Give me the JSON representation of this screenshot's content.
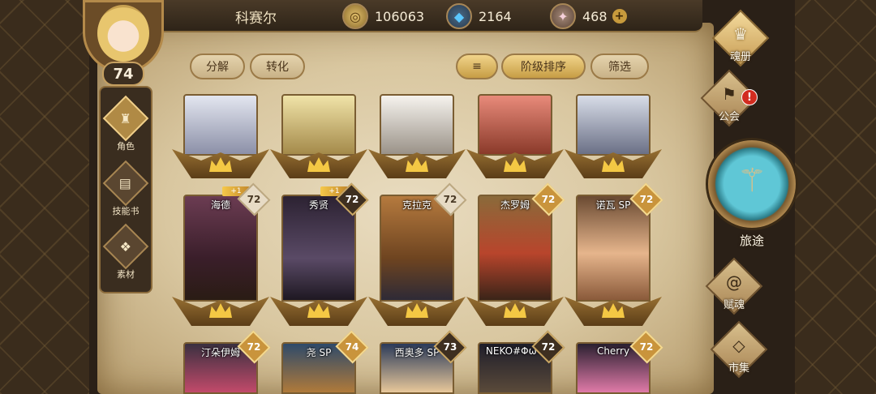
{
  "player": {
    "name": "科赛尔",
    "level": "74"
  },
  "resources": {
    "gold": "106063",
    "gems": "2164",
    "crystals": "468",
    "add_label": "+"
  },
  "toolbar": {
    "decompose": "分解",
    "convert": "转化",
    "sort_by_tier": "阶级排序",
    "filter": "筛选"
  },
  "left_nav": [
    {
      "label": "角色",
      "icon": "helmet-icon"
    },
    {
      "label": "技能书",
      "icon": "skillbook-icon"
    },
    {
      "label": "素材",
      "icon": "material-icon"
    }
  ],
  "right_nav": {
    "soul_book": "魂册",
    "guild": "公会",
    "guild_alert": "!",
    "journey": "旅途",
    "endow_soul": "赋魂",
    "market": "市集"
  },
  "cards_row1": [
    {
      "name": "",
      "level": ""
    },
    {
      "name": "",
      "level": ""
    },
    {
      "name": "",
      "level": ""
    },
    {
      "name": "",
      "level": ""
    },
    {
      "name": "",
      "level": ""
    }
  ],
  "cards_row2": [
    {
      "name": "海德",
      "level": "72",
      "bonus": "+1",
      "badge": "plain"
    },
    {
      "name": "秀贤",
      "level": "72",
      "bonus": "+1",
      "badge": "dark"
    },
    {
      "name": "克拉克",
      "level": "72",
      "bonus": "",
      "badge": "plain"
    },
    {
      "name": "杰罗姆",
      "level": "72",
      "bonus": "",
      "badge": "gold"
    },
    {
      "name": "诺瓦 SP",
      "level": "72",
      "bonus": "",
      "badge": "gold"
    }
  ],
  "cards_row3": [
    {
      "name": "汀朵伊姆",
      "level": "72",
      "badge": "gold"
    },
    {
      "name": "尧 SP",
      "level": "74",
      "badge": "gold"
    },
    {
      "name": "西奥多 SP",
      "level": "73",
      "badge": "dark"
    },
    {
      "name": "NEKO#ΦωΦ",
      "level": "72",
      "badge": "dark"
    },
    {
      "name": "Cherry",
      "level": "72",
      "badge": "gold"
    }
  ],
  "colors": {
    "accent_gold": "#c79d45",
    "frame_brown": "#8d6f3f",
    "alert_red": "#d22c1f",
    "journey_teal": "#5fc7d6"
  }
}
